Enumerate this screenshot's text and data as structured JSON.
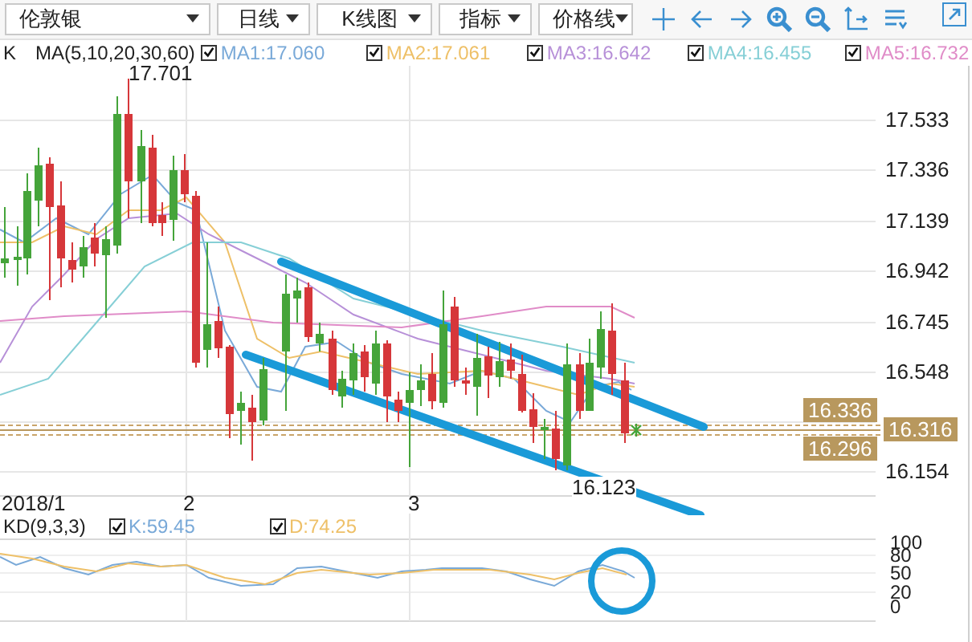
{
  "toolbar": {
    "dropdowns": [
      {
        "label": "伦敦银"
      },
      {
        "label": "日线"
      },
      {
        "label": "K线图"
      },
      {
        "label": "指标"
      },
      {
        "label": "价格线"
      }
    ]
  },
  "ma_legend": {
    "label": "K",
    "params": "MA(5,10,20,30,60)",
    "items": [
      {
        "label": "MA1:17.060",
        "checked": true,
        "color": "#79a9d8"
      },
      {
        "label": "MA2:17.061",
        "checked": true,
        "color": "#eec068"
      },
      {
        "label": "MA3:16.642",
        "checked": true,
        "color": "#b790d8"
      },
      {
        "label": "MA4:16.455",
        "checked": true,
        "color": "#86cfd6"
      },
      {
        "label": "MA5:16.732",
        "checked": true,
        "color": "#e08cc8"
      }
    ]
  },
  "price_chart": {
    "high_label": "17.701",
    "low_label": "16.123",
    "y_axis_labels": [
      "17.533",
      "17.336",
      "17.139",
      "16.942",
      "16.745",
      "16.548",
      "16.154"
    ],
    "price_tags": [
      {
        "text": "16.336",
        "kind": "side"
      },
      {
        "text": "16.316",
        "kind": "axis"
      },
      {
        "text": "16.296",
        "kind": "side"
      }
    ],
    "x_axis_labels": [
      "2018/1",
      "2",
      "3"
    ]
  },
  "kd_panel": {
    "params": "KD(9,3,3)",
    "items": [
      {
        "label": "K:59.45",
        "checked": true,
        "color": "#79a9d8"
      },
      {
        "label": "D:74.25",
        "checked": true,
        "color": "#eec068"
      }
    ],
    "y_axis_labels": [
      "100",
      "80",
      "50",
      "20",
      "0"
    ]
  }
}
